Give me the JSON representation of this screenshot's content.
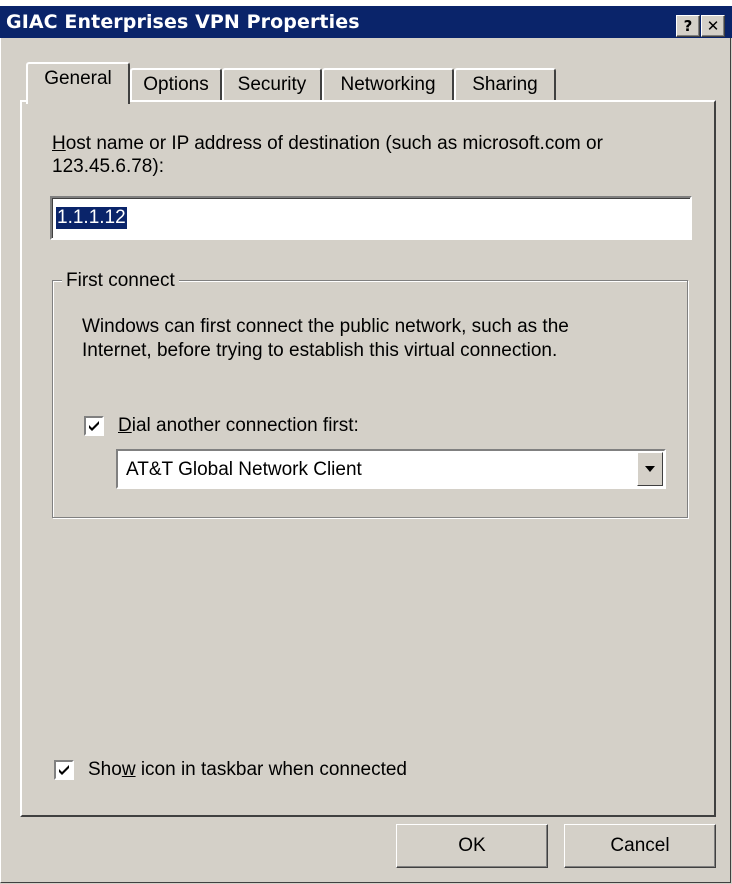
{
  "window": {
    "title": "GIAC Enterprises VPN Properties",
    "help_glyph": "?",
    "close_glyph": "✕"
  },
  "tabs": [
    {
      "label": "General",
      "active": true
    },
    {
      "label": "Options",
      "active": false
    },
    {
      "label": "Security",
      "active": false
    },
    {
      "label": "Networking",
      "active": false
    },
    {
      "label": "Sharing",
      "active": false
    }
  ],
  "general": {
    "host_label_line1_key": "H",
    "host_label_line1_rest": "ost name or IP address of destination (such as microsoft.com or",
    "host_label_line2": "123.45.6.78):",
    "host_value": "1.1.1.12",
    "first_connect": {
      "legend": "First connect",
      "description_line1": "Windows can first connect the public network, such as the",
      "description_line2": "Internet, before trying to establish this virtual connection.",
      "dial_checkbox_checked": true,
      "dial_label_key": "D",
      "dial_label_rest": "ial another connection first:",
      "dial_selected": "AT&T Global Network Client"
    },
    "show_icon_checked": true,
    "show_icon_label_pre": "Sho",
    "show_icon_label_key": "w",
    "show_icon_label_post": " icon in taskbar when connected"
  },
  "buttons": {
    "ok": "OK",
    "cancel": "Cancel"
  },
  "colors": {
    "titlebar": "#0a246a",
    "face": "#d4d0c8",
    "selection": "#0a246a"
  }
}
